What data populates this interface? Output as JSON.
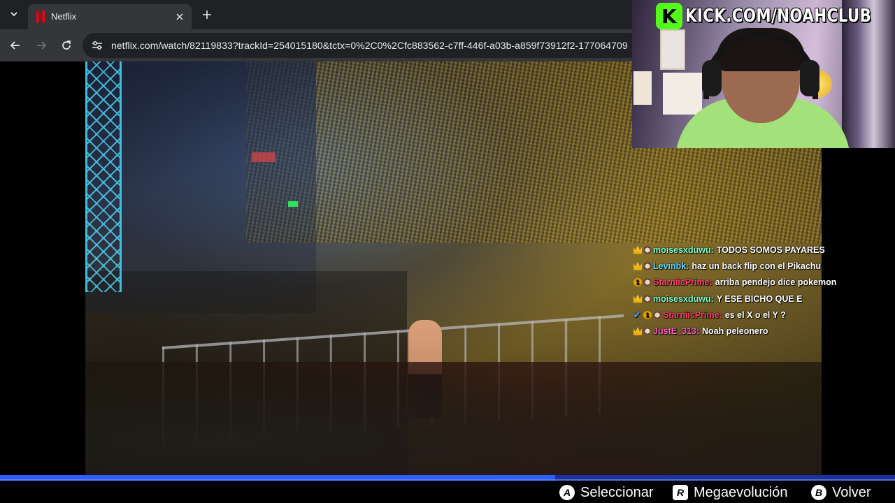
{
  "browser": {
    "tab": {
      "title": "Netflix",
      "favicon": "netflix-n-logo",
      "favicon_color": "#e50914"
    },
    "url": "netflix.com/watch/82119833?trackId=254015180&tctx=0%2C0%2Cfc883562-c7ff-446f-a03b-a859f73912f2-177064709"
  },
  "video": {
    "description_icon": "wrestling-arena-video"
  },
  "overlay": {
    "kick_url": "KICK.COM/NOAHCLUB",
    "kick_logo_letter": "K",
    "kick_color": "#53fc18"
  },
  "chat": [
    {
      "user": "moisesxduwu:",
      "message": "TODOS SOMOS PAYARES",
      "color": "#7fffd0",
      "badges": [
        "crown",
        "emote"
      ]
    },
    {
      "user": "Levinbk:",
      "message": "haz un back flip con el Pikachu",
      "color": "#5dd9ff",
      "badges": [
        "crown",
        "emote"
      ]
    },
    {
      "user": "StarniicPrime:",
      "message": "arriba pendejo dice pokemon",
      "color": "#ff3f6a",
      "badges": [
        "one",
        "emote"
      ]
    },
    {
      "user": "moisesxduwu:",
      "message": "Y ESE BICHO QUE E",
      "color": "#7fffd0",
      "badges": [
        "crown",
        "emote"
      ]
    },
    {
      "user": "StarniicPrime:",
      "message": "es el X o el Y ?",
      "color": "#ff3f6a",
      "badges": [
        "check",
        "one",
        "emote"
      ]
    },
    {
      "user": "JustE_313:",
      "message": "Noah peleonero",
      "color": "#ff5dc8",
      "badges": [
        "crown",
        "emote"
      ]
    }
  ],
  "progress": {
    "fraction": 0.62,
    "track_color": "#1d2f9b",
    "fill_color": "#2f5bff"
  },
  "controls": [
    {
      "key": "A",
      "label": "Seleccionar"
    },
    {
      "key": "R",
      "label": "Megaevolución"
    },
    {
      "key": "B",
      "label": "Volver"
    }
  ]
}
